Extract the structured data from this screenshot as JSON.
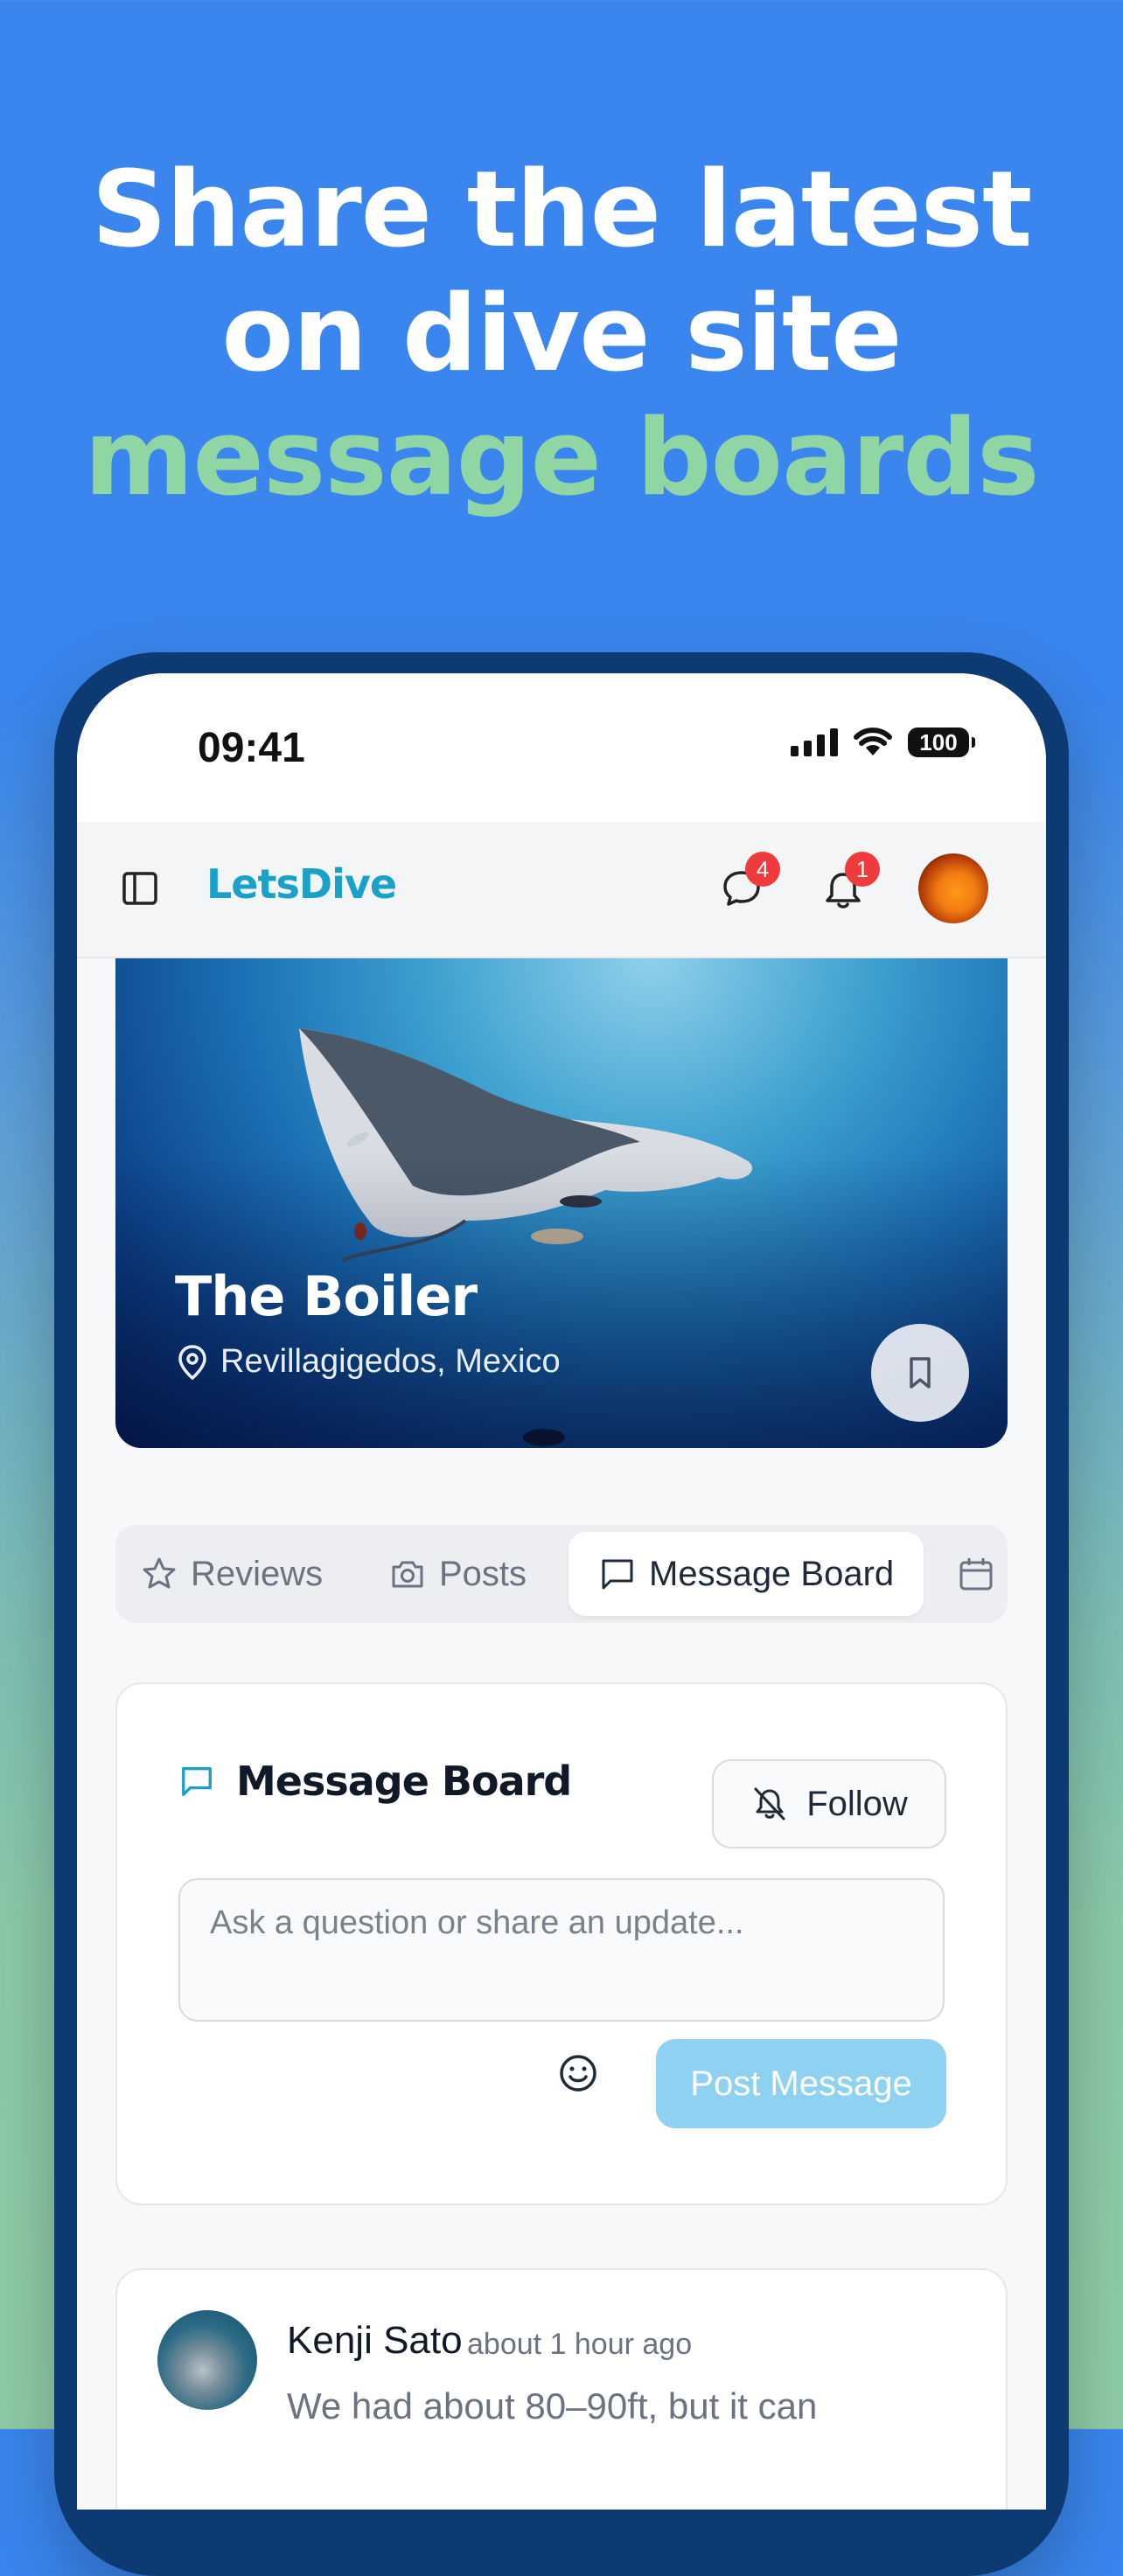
{
  "headline": {
    "line1": "Share the latest",
    "line2": "on dive site",
    "line3": "message boards"
  },
  "status_bar": {
    "time": "09:41",
    "battery": "100"
  },
  "app_bar": {
    "brand": "LetsDive",
    "messages_badge": "4",
    "notifications_badge": "1"
  },
  "hero": {
    "site_name": "The Boiler",
    "location": "Revillagigedos, Mexico"
  },
  "tabs": [
    {
      "label": "Reviews",
      "icon": "star-icon"
    },
    {
      "label": "Posts",
      "icon": "camera-icon"
    },
    {
      "label": "Message Board",
      "icon": "message-square-icon",
      "active": true
    },
    {
      "label": "",
      "icon": "calendar-icon"
    }
  ],
  "message_board": {
    "title": "Message Board",
    "follow_label": "Follow",
    "input_placeholder": "Ask a question or share an update...",
    "post_label": "Post Message"
  },
  "posts": [
    {
      "author": "Kenji Sato",
      "time": "about 1 hour ago",
      "body": "We had about 80–90ft, but it can"
    }
  ],
  "colors": {
    "background": "#3a86ee",
    "accent_green": "#8fd6a4",
    "brand": "#1aa1c9",
    "badge": "#ef3b3b",
    "post_button": "#8fd1f0"
  }
}
